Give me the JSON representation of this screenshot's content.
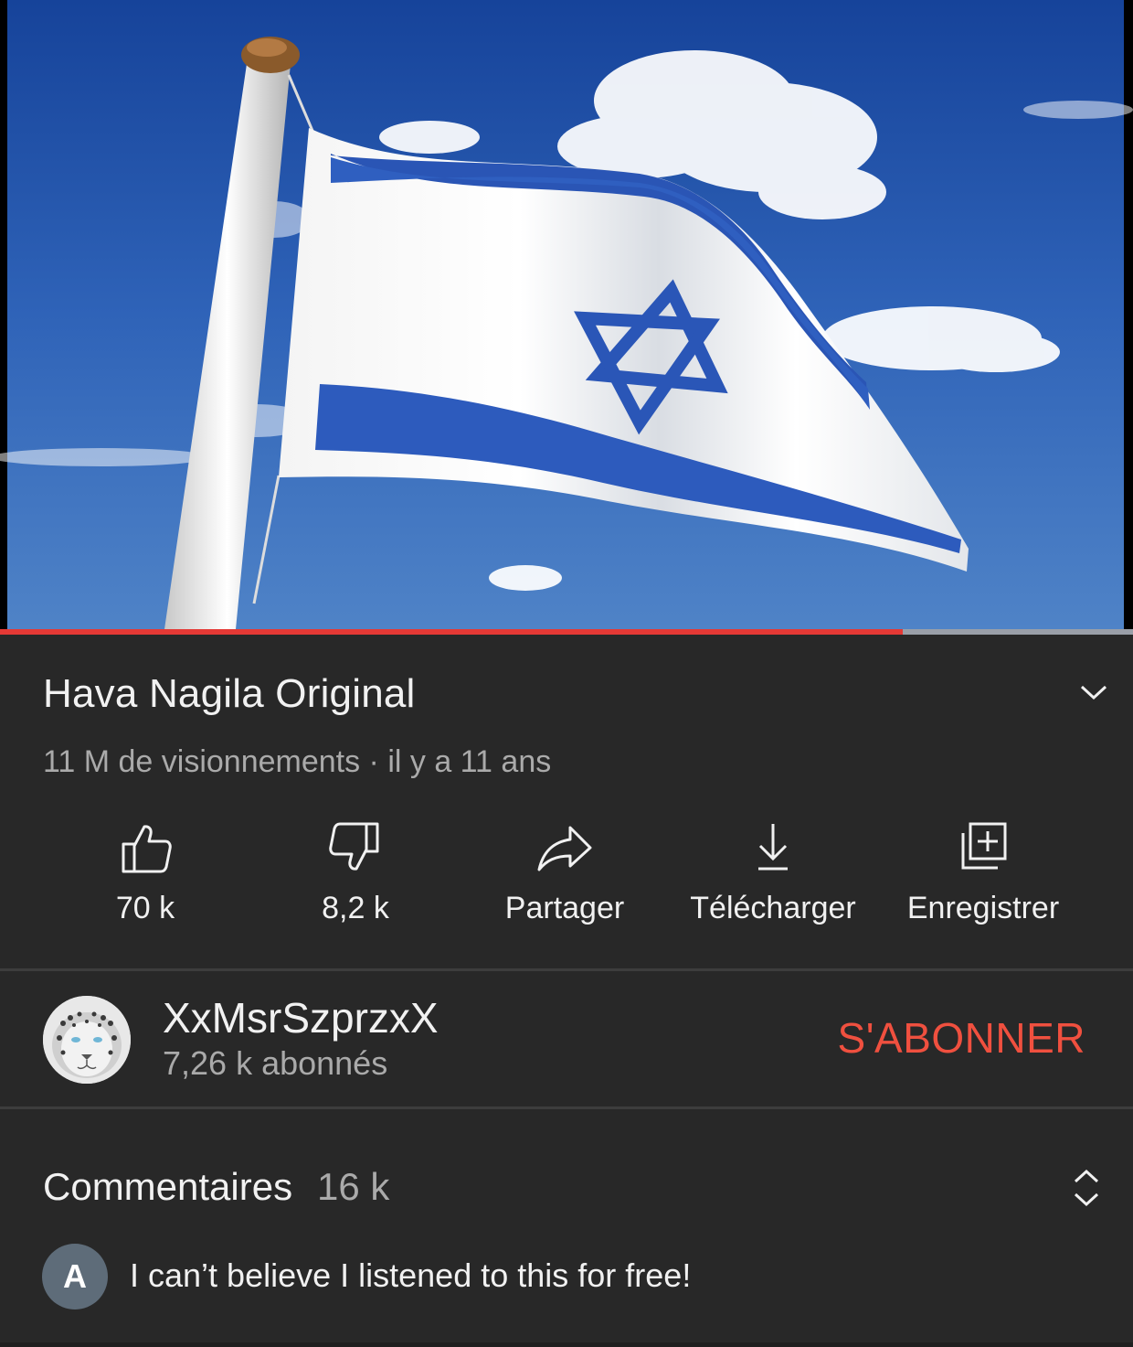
{
  "video": {
    "progress": 0.797,
    "colors": {
      "progress": "#e53935",
      "track": "#9a9fa8"
    }
  },
  "title": "Hava Nagila Original",
  "meta": "11 M de visionnements · il y a 11 ans",
  "actions": [
    {
      "label": "70 k",
      "icon": "thumbs-up-icon"
    },
    {
      "label": "8,2 k",
      "icon": "thumbs-down-icon"
    },
    {
      "label": "Partager",
      "icon": "share-icon"
    },
    {
      "label": "Télécharger",
      "icon": "download-icon"
    },
    {
      "label": "Enregistrer",
      "icon": "add-to-playlist-icon"
    }
  ],
  "channel": {
    "name": "XxMsrSzprzxX",
    "subscribers": "7,26 k abonnés",
    "subscribe_label": "S'ABONNER",
    "subscribe_color": "#f0503f"
  },
  "comments": {
    "title": "Commentaires",
    "count": "16 k",
    "first": {
      "avatar_letter": "A",
      "text": "I can’t believe I listened to this for free!"
    }
  }
}
